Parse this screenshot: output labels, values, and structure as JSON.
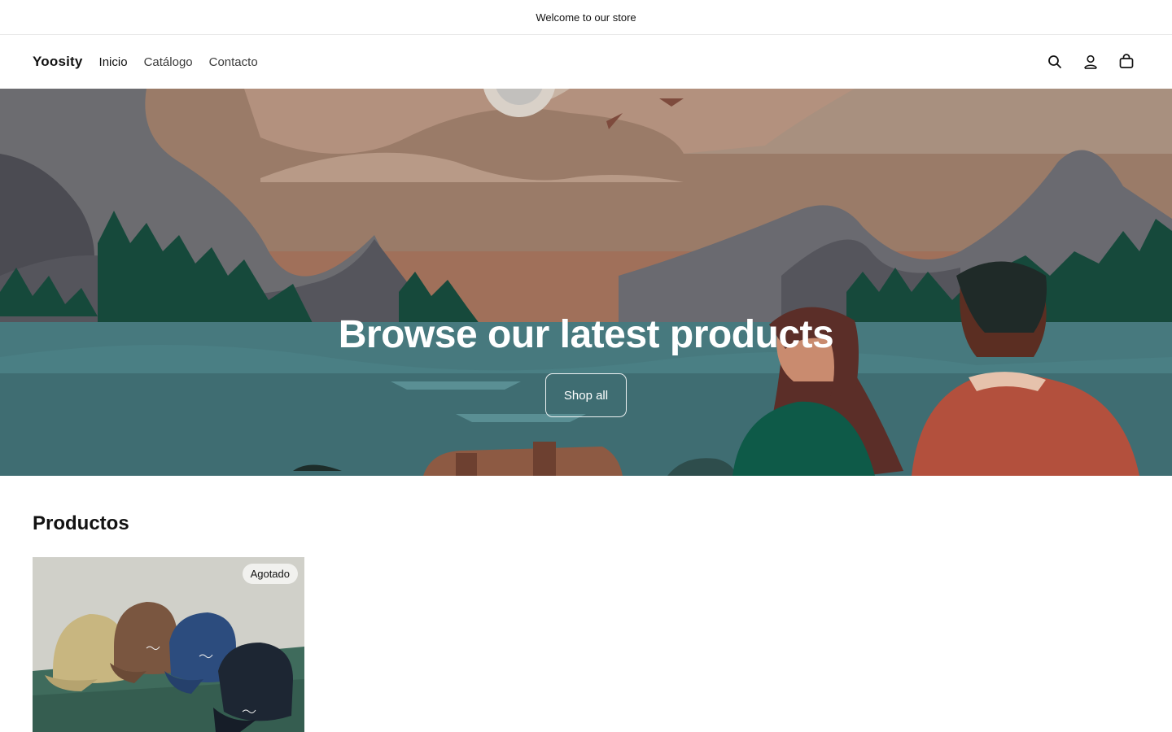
{
  "announcement": {
    "text": "Welcome to our store"
  },
  "header": {
    "logo": "Yoosity",
    "nav": [
      {
        "label": "Inicio"
      },
      {
        "label": "Catálogo"
      },
      {
        "label": "Contacto"
      }
    ],
    "icons": [
      "search-icon",
      "account-icon",
      "cart-icon"
    ]
  },
  "hero": {
    "title": "Browse our latest products",
    "button_label": "Shop all"
  },
  "products": {
    "title": "Productos",
    "items": [
      {
        "badge": "Agotado"
      }
    ]
  }
}
